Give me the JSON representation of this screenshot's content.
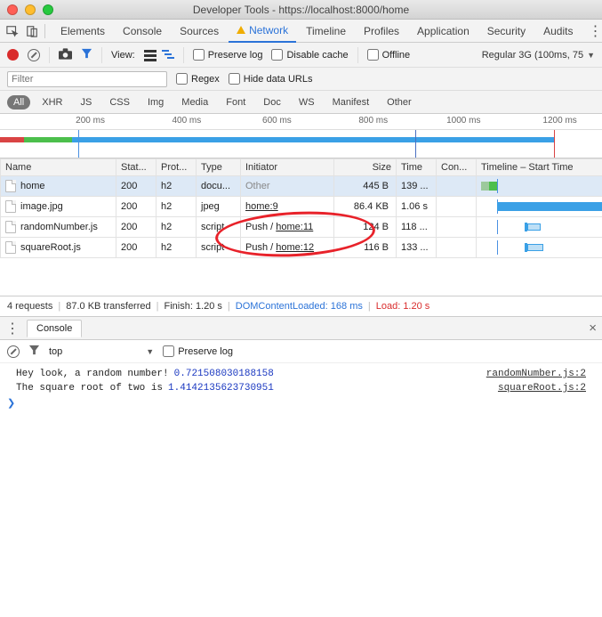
{
  "window": {
    "title": "Developer Tools - https://localhost:8000/home"
  },
  "tabs": {
    "elements": "Elements",
    "console": "Console",
    "sources": "Sources",
    "network": "Network",
    "timeline": "Timeline",
    "profiles": "Profiles",
    "application": "Application",
    "security": "Security",
    "audits": "Audits"
  },
  "toolbar": {
    "view_label": "View:",
    "preserve_log": "Preserve log",
    "disable_cache": "Disable cache",
    "offline": "Offline",
    "throttle": "Regular 3G (100ms, 75"
  },
  "filterbar": {
    "placeholder": "Filter",
    "regex": "Regex",
    "hide_data_urls": "Hide data URLs"
  },
  "types": {
    "all": "All",
    "xhr": "XHR",
    "js": "JS",
    "css": "CSS",
    "img": "Img",
    "media": "Media",
    "font": "Font",
    "doc": "Doc",
    "ws": "WS",
    "manifest": "Manifest",
    "other": "Other"
  },
  "ruler": [
    "200 ms",
    "400 ms",
    "600 ms",
    "800 ms",
    "1000 ms",
    "1200 ms"
  ],
  "columns": {
    "name": "Name",
    "status": "Stat...",
    "protocol": "Prot...",
    "type": "Type",
    "initiator": "Initiator",
    "size": "Size",
    "time": "Time",
    "connection": "Con...",
    "timeline": "Timeline – Start Time"
  },
  "rows": [
    {
      "name": "home",
      "status": "200",
      "protocol": "h2",
      "type": "docu...",
      "initiator": "Other",
      "init_push": "",
      "size": "445 B",
      "time": "139 ..."
    },
    {
      "name": "image.jpg",
      "status": "200",
      "protocol": "h2",
      "type": "jpeg",
      "initiator": "home:9",
      "init_push": "",
      "size": "86.4 KB",
      "time": "1.06 s"
    },
    {
      "name": "randomNumber.js",
      "status": "200",
      "protocol": "h2",
      "type": "script",
      "initiator": "home:11",
      "init_push": "Push / ",
      "size": "124 B",
      "time": "118 ..."
    },
    {
      "name": "squareRoot.js",
      "status": "200",
      "protocol": "h2",
      "type": "script",
      "initiator": "home:12",
      "init_push": "Push / ",
      "size": "116 B",
      "time": "133 ..."
    }
  ],
  "status": {
    "requests": "4 requests",
    "transferred": "87.0 KB transferred",
    "finish": "Finish: 1.20 s",
    "dcl_label": "DOMContentLoaded: ",
    "dcl_val": "168 ms",
    "load_label": "Load: ",
    "load_val": "1.20 s"
  },
  "drawer": {
    "tab": "Console",
    "context": "top",
    "preserve_log": "Preserve log"
  },
  "console": [
    {
      "msg": "Hey look, a random number! ",
      "num": "0.721508030188158",
      "src": "randomNumber.js:2"
    },
    {
      "msg": "The square root of two is ",
      "num": "1.4142135623730951",
      "src": "squareRoot.js:2"
    }
  ],
  "prompt": "❯"
}
